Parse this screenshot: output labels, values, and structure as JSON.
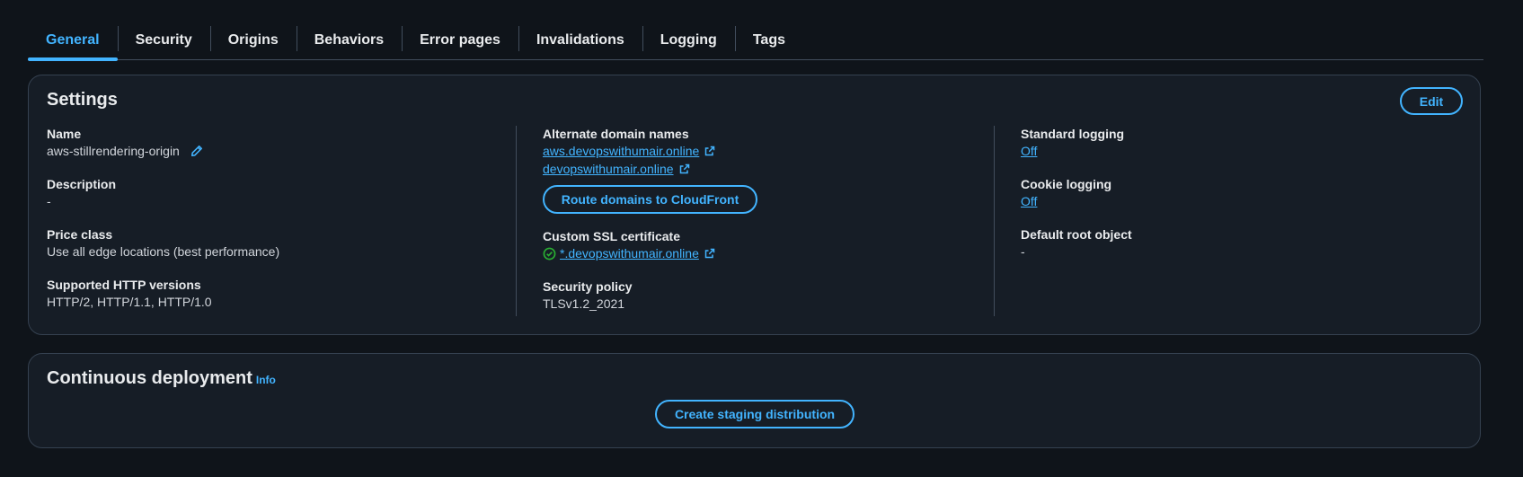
{
  "tabs": [
    {
      "label": "General",
      "active": true
    },
    {
      "label": "Security",
      "active": false
    },
    {
      "label": "Origins",
      "active": false
    },
    {
      "label": "Behaviors",
      "active": false
    },
    {
      "label": "Error pages",
      "active": false
    },
    {
      "label": "Invalidations",
      "active": false
    },
    {
      "label": "Logging",
      "active": false
    },
    {
      "label": "Tags",
      "active": false
    }
  ],
  "settings": {
    "title": "Settings",
    "edit_label": "Edit",
    "name": {
      "label": "Name",
      "value": "aws-stillrendering-origin"
    },
    "description": {
      "label": "Description",
      "value": "-"
    },
    "price_class": {
      "label": "Price class",
      "value": "Use all edge locations (best performance)"
    },
    "http_versions": {
      "label": "Supported HTTP versions",
      "value": "HTTP/2, HTTP/1.1, HTTP/1.0"
    },
    "alternate_domains": {
      "label": "Alternate domain names",
      "items": [
        "aws.devopswithumair.online",
        "devopswithumair.online"
      ]
    },
    "route_button_label": "Route domains to CloudFront",
    "ssl_certificate": {
      "label": "Custom SSL certificate",
      "value": "*.devopswithumair.online"
    },
    "security_policy": {
      "label": "Security policy",
      "value": "TLSv1.2_2021"
    },
    "standard_logging": {
      "label": "Standard logging",
      "value": "Off"
    },
    "cookie_logging": {
      "label": "Cookie logging",
      "value": "Off"
    },
    "default_root_object": {
      "label": "Default root object",
      "value": "-"
    }
  },
  "continuous_deployment": {
    "title": "Continuous deployment",
    "info_label": "Info",
    "staging_button_label": "Create staging distribution"
  },
  "colors": {
    "accent": "#42b4ff",
    "success": "#29ad32",
    "background": "#0f141a",
    "panel": "#161d26"
  }
}
